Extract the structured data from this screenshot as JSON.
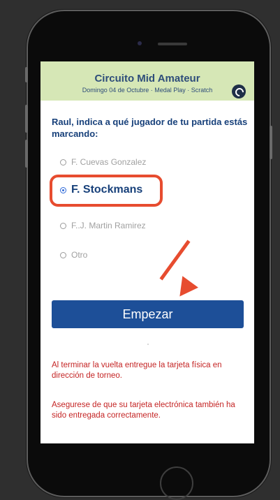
{
  "header": {
    "title": "Circuito Mid Amateur",
    "subtitle": "Domingo 04 de Octubre · Medal Play · Scratch",
    "icon": "wrench-icon"
  },
  "prompt": "Raul, indica a qué jugador de tu partida estás marcando:",
  "options": [
    {
      "label": "F. Cuevas Gonzalez",
      "selected": false
    },
    {
      "label": "F. Stockmans",
      "selected": true
    },
    {
      "label": "F..J. Martin Ramirez",
      "selected": false
    },
    {
      "label": "Otro",
      "selected": false
    }
  ],
  "start_button": "Empezar",
  "notices": [
    "Al terminar la vuelta entregue la tarjeta física en dirección de torneo.",
    "Asegurese de que su tarjeta electrónica también ha sido entregada correctamente."
  ],
  "colors": {
    "header_bg": "#d6e7b6",
    "primary": "#1d4f98",
    "annotation": "#e74c2f",
    "notice_text": "#c42424"
  }
}
